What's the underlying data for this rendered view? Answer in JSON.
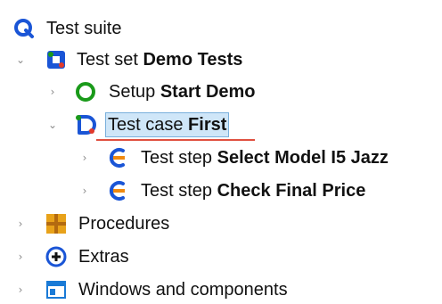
{
  "tree": {
    "suite": {
      "label": "Test suite"
    },
    "set": {
      "prefix": "Test set",
      "name": "Demo Tests"
    },
    "setup": {
      "prefix": "Setup",
      "name": "Start Demo"
    },
    "testcase": {
      "prefix": "Test case",
      "name": "First"
    },
    "step1": {
      "prefix": "Test step",
      "name": "Select Model I5 Jazz"
    },
    "step2": {
      "prefix": "Test step",
      "name": "Check Final Price"
    },
    "procedures": {
      "label": "Procedures"
    },
    "extras": {
      "label": "Extras"
    },
    "windows": {
      "label": "Windows and components"
    }
  },
  "colors": {
    "accent_blue": "#1a55d6",
    "setup_green": "#1a9a1a",
    "test_orange": "#f08a10",
    "test_red": "#e23a2a",
    "selection_bg": "#cfe6f8",
    "procedures_gold": "#e8a21a"
  }
}
